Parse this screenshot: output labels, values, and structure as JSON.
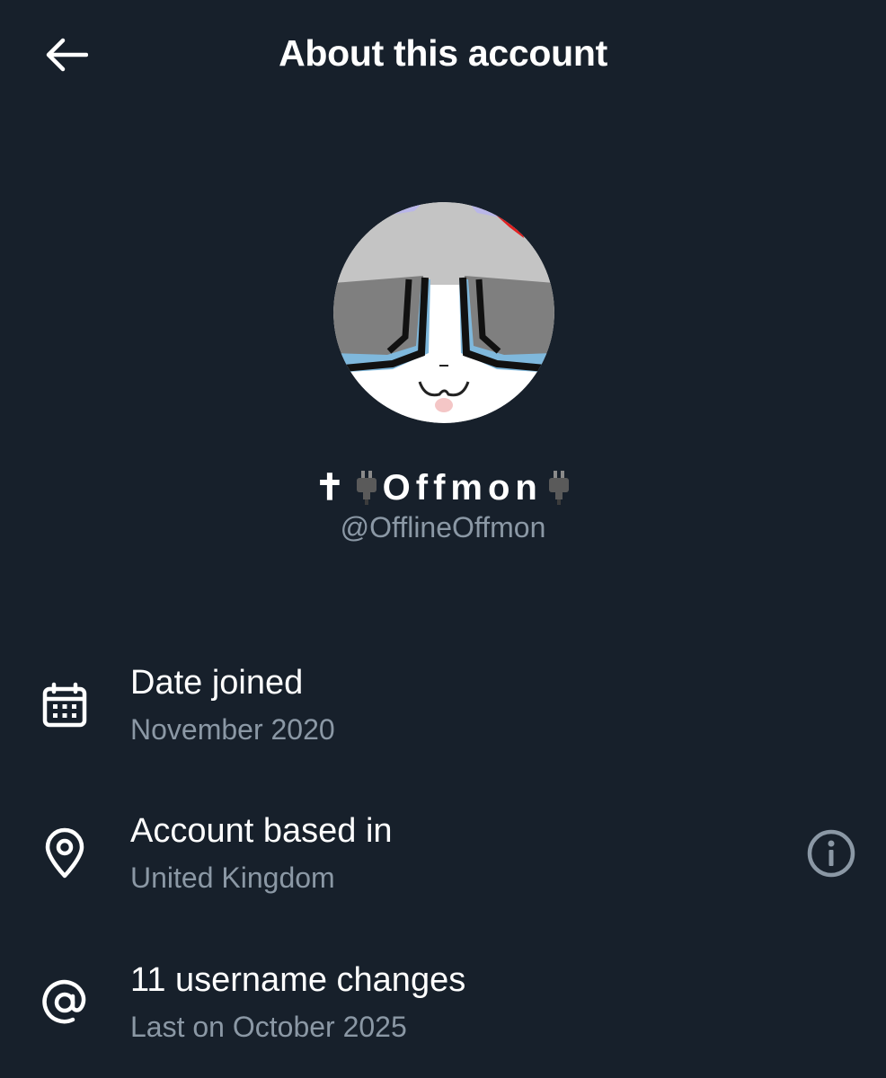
{
  "header": {
    "title": "About this account",
    "back_icon": "arrow-left-icon"
  },
  "profile": {
    "display_name_prefix": "✝",
    "display_name_text": "Offmon",
    "display_name_icon": "electric-plug-icon",
    "handle": "@OfflineOffmon",
    "avatar_icon": "avatar-image"
  },
  "rows": [
    {
      "icon": "calendar-icon",
      "title": "Date joined",
      "subtitle": "November 2020"
    },
    {
      "icon": "location-pin-icon",
      "title": "Account based in",
      "subtitle": "United Kingdom",
      "action_icon": "info-icon"
    },
    {
      "icon": "at-sign-icon",
      "title": "11 username changes",
      "subtitle": "Last on October 2025"
    }
  ],
  "colors": {
    "background": "#17202b",
    "primary_text": "#ffffff",
    "secondary_text": "#8b98a5",
    "info_icon": "#8b98a5"
  }
}
